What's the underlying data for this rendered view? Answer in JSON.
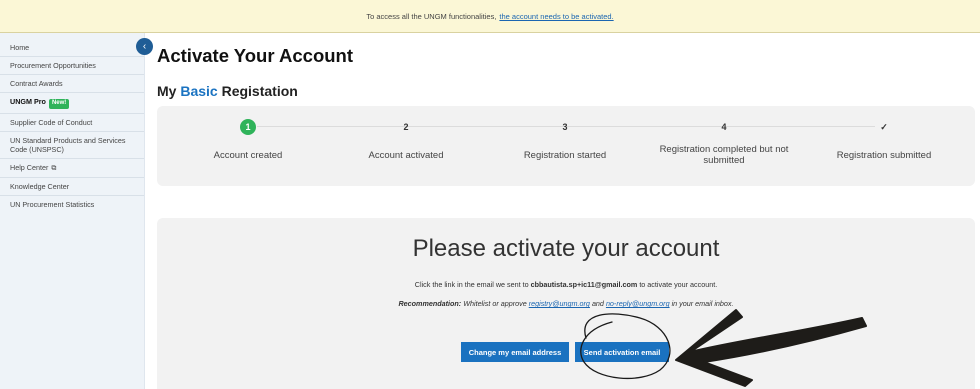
{
  "banner": {
    "text": "To access all the UNGM functionalities,",
    "link": "the account needs to be activated."
  },
  "sidebar": {
    "items": [
      {
        "label": "Home"
      },
      {
        "label": "Procurement Opportunities"
      },
      {
        "label": "Contract Awards"
      },
      {
        "label": "UNGM Pro",
        "badge": "New!"
      },
      {
        "label": "Supplier Code of Conduct"
      },
      {
        "label": "UN Standard Products and Services Code (UNSPSC)"
      },
      {
        "label": "Help Center"
      },
      {
        "label": "Knowledge Center"
      },
      {
        "label": "UN Procurement Statistics"
      }
    ],
    "collapse_icon": "chevron-left-icon"
  },
  "main": {
    "title": "Activate Your Account",
    "subtitle_prefix": "My",
    "subtitle_accent": "Basic",
    "subtitle_suffix": "Registation"
  },
  "steps": [
    {
      "number": "1",
      "label": "Account created",
      "status": "done"
    },
    {
      "number": "2",
      "label": "Account activated",
      "status": "pending"
    },
    {
      "number": "3",
      "label": "Registration started",
      "status": "pending"
    },
    {
      "number": "4",
      "label": "Registration completed but not submitted",
      "status": "pending"
    },
    {
      "number": "✓",
      "label": "Registration submitted",
      "status": "pending"
    }
  ],
  "activation": {
    "heading": "Please activate your account",
    "msg_pre": "Click the link in the email we sent to",
    "email": "cbbautista.sp+ic11@gmail.com",
    "msg_post": "to activate your account.",
    "rec_label": "Recommendation:",
    "rec_text": "Whitelist or approve",
    "rec_email1": "registry@ungm.org",
    "rec_and": "and",
    "rec_email2": "no-reply@ungm.org",
    "rec_end": "in your email inbox.",
    "change_button": "Change my email address",
    "send_button": "Send activation email"
  },
  "colors": {
    "accent": "#1a72c0",
    "success": "#2fb35a",
    "banner_bg": "#fbf7d6"
  }
}
